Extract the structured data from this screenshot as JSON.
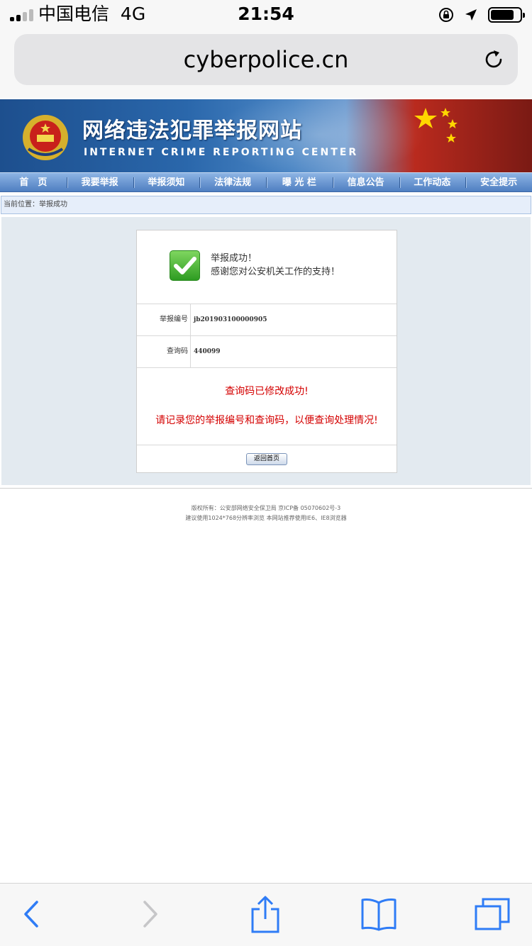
{
  "status": {
    "carrier": "中国电信",
    "network": "4G",
    "time": "21:54"
  },
  "browser": {
    "url": "cyberpolice.cn"
  },
  "site": {
    "title": "网络违法犯罪举报网站",
    "subtitle": "INTERNET CRIME REPORTING CENTER",
    "nav": [
      "首　页",
      "我要举报",
      "举报须知",
      "法律法规",
      "曝 光 栏",
      "信息公告",
      "工作动态",
      "安全提示"
    ],
    "breadcrumb": "当前位置：举报成功"
  },
  "result": {
    "success_line1": "举报成功！",
    "success_line2": "感谢您对公安机关工作的支持！",
    "report_no_label": "举报编号",
    "report_no": "jb201903100000905",
    "query_code_label": "查询码",
    "query_code": "440099",
    "notice1": "查询码已修改成功!",
    "notice2": "请记录您的举报编号和查询码，以便查询处理情况!",
    "back_button": "返回首页"
  },
  "footer": {
    "line1": "版权所有：公安部网络安全保卫局 京ICP备 05070602号-3",
    "line2": "建议使用1024*768分辨率浏览 本网站推荐使用IE6、IE8浏览器"
  },
  "colors": {
    "accent_blue": "#2f7cf6",
    "notice_red": "#d40000"
  },
  "icons": {
    "signal": "signal-bars-icon",
    "orientation_lock": "orientation-lock-icon",
    "location": "location-arrow-icon",
    "battery": "battery-icon",
    "reload": "reload-icon",
    "back": "chevron-left-icon",
    "forward": "chevron-right-icon",
    "share": "share-icon",
    "bookmarks": "book-icon",
    "tabs": "tabs-icon"
  }
}
